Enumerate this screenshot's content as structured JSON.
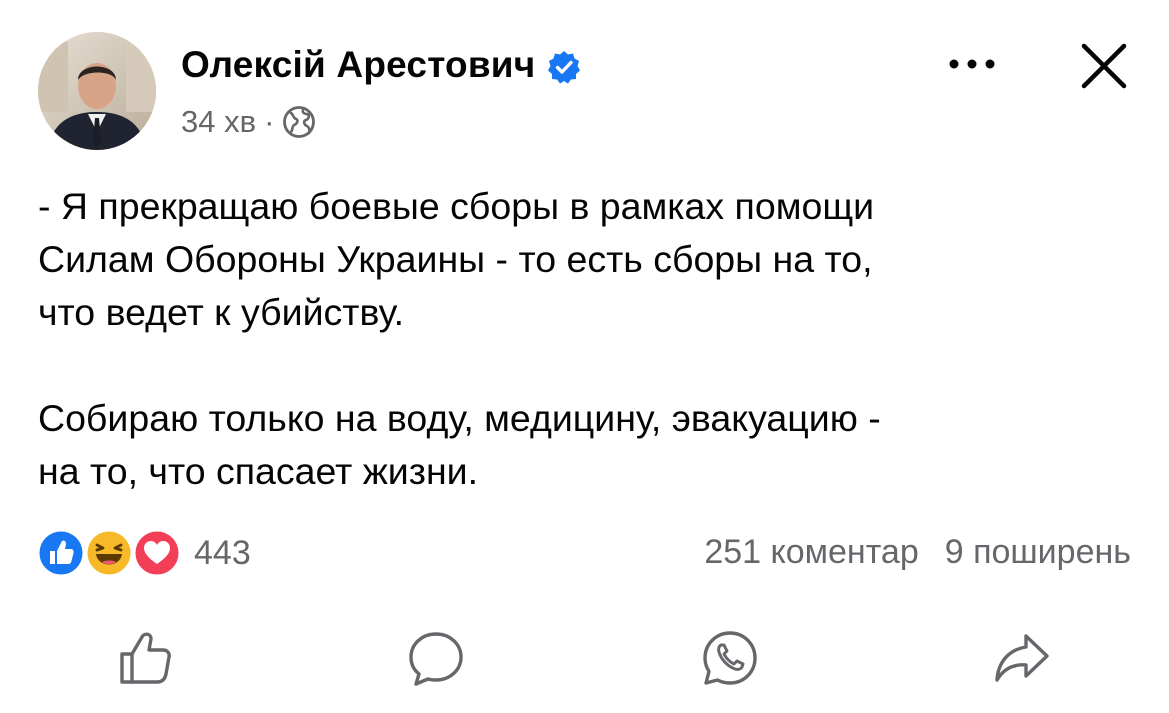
{
  "post": {
    "author": "Олексій Арестович",
    "time": "34 хв",
    "separator": "·",
    "text_lines": [
      "- Я прекращаю боевые сборы в рамках помощи",
      "Силам Обороны Украины - то есть сборы на то,",
      "что ведет к убийству.",
      "Собираю только на воду, медицину, эвакуацию -",
      "на то, что спасает жизни."
    ],
    "reactions_count": "443",
    "comments": "251 коментар",
    "shares": "9 поширень"
  },
  "icons": {
    "verified": "verified-badge-icon",
    "privacy": "globe-icon",
    "more": "more-options-icon",
    "close": "close-icon",
    "like": "like-icon",
    "comment": "comment-icon",
    "whatsapp": "whatsapp-icon",
    "share": "share-icon"
  },
  "colors": {
    "verified": "#1877f2",
    "like_reaction": "#1877f2",
    "love_reaction": "#f33e58",
    "haha_reaction": "#f7b928",
    "secondary_text": "#65676b"
  }
}
